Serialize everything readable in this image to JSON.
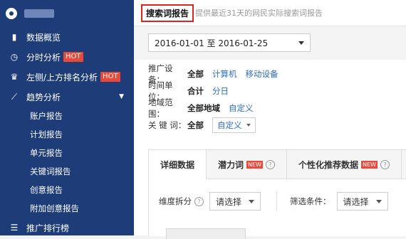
{
  "sidebar": {
    "items": [
      {
        "icon": "bar-chart-icon",
        "label": "数据概览"
      },
      {
        "icon": "clock-icon",
        "label": "分时分析",
        "badge": "HOT"
      },
      {
        "icon": "trophy-icon",
        "label": "左侧/上方排名分析",
        "badge": "HOT"
      },
      {
        "icon": "trend-icon",
        "label": "趋势分析"
      }
    ],
    "subitems": [
      "账户报告",
      "计划报告",
      "单元报告",
      "关键词报告",
      "创意报告",
      "附加创意报告"
    ],
    "bottom": {
      "icon": "list-icon",
      "label": "推广排行榜"
    }
  },
  "header": {
    "title": "搜索词报告",
    "subtitle": "提供最近31天的网民实际搜索词报告"
  },
  "date_range": {
    "value": "2016-01-01 至 2016-01-25"
  },
  "filters": {
    "device": {
      "label": "推广设备：",
      "options": [
        "全部",
        "计算机",
        "移动设备"
      ]
    },
    "time_unit": {
      "label": "时间单位：",
      "options": [
        "合计",
        "分日"
      ]
    },
    "region": {
      "label": "地域范围：",
      "options": [
        "全部地域",
        "自定义"
      ]
    },
    "keyword": {
      "label": "关 键 词：",
      "options": [
        "全部",
        "自定义"
      ]
    }
  },
  "tabs": [
    {
      "label": "详细数据"
    },
    {
      "label": "潜力词",
      "badge": "NEW"
    },
    {
      "label": "个性化推荐数据",
      "badge": "NEW"
    }
  ],
  "dimension": {
    "label": "维度拆分",
    "placeholder": "请选择"
  },
  "condition": {
    "label": "筛选条件：",
    "placeholder": "请选择"
  },
  "colors": {
    "sidebar": "#1d3c78",
    "accent_red": "#d22222",
    "link": "#2a6dc6"
  }
}
